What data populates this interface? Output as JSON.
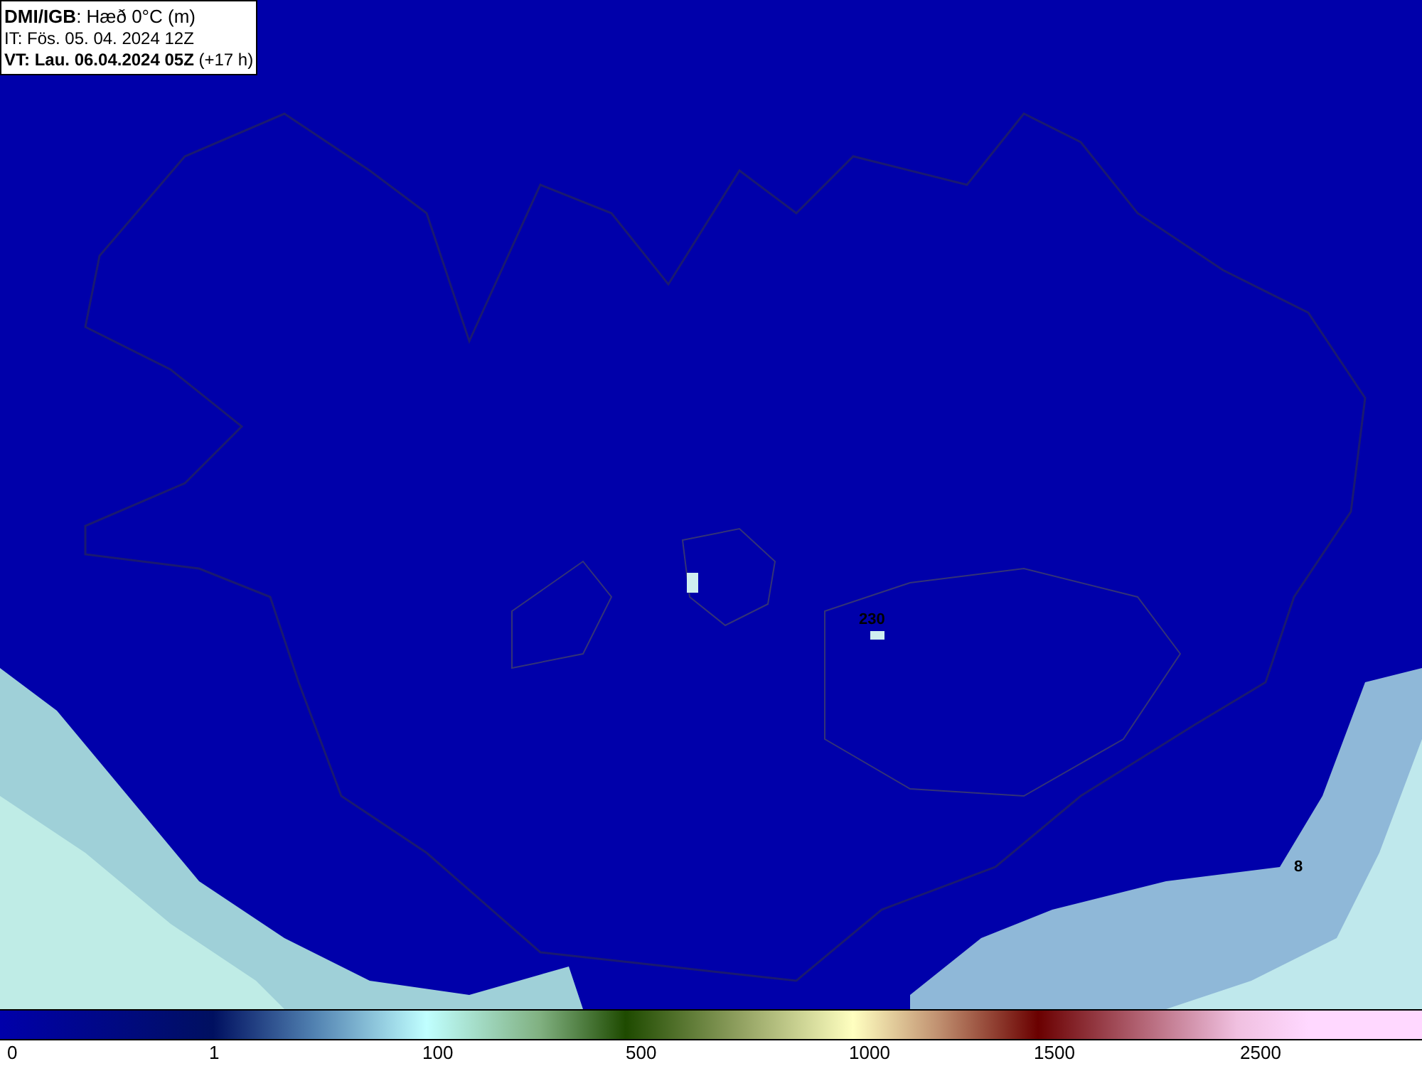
{
  "header": {
    "lines": [
      "**DMI/IGB**: Hæð 0°C (m)",
      "IT: Fös. 05. 04. 2024 12Z",
      "**VT: Lau. 06.04.2024 05Z** (+17 h)"
    ]
  },
  "map": {
    "labels": [
      {
        "text": "230"
      },
      {
        "text": "8"
      }
    ]
  },
  "color_scale": {
    "ticks": [
      "0",
      "1",
      "100",
      "500",
      "1000",
      "1500",
      "2500"
    ]
  }
}
